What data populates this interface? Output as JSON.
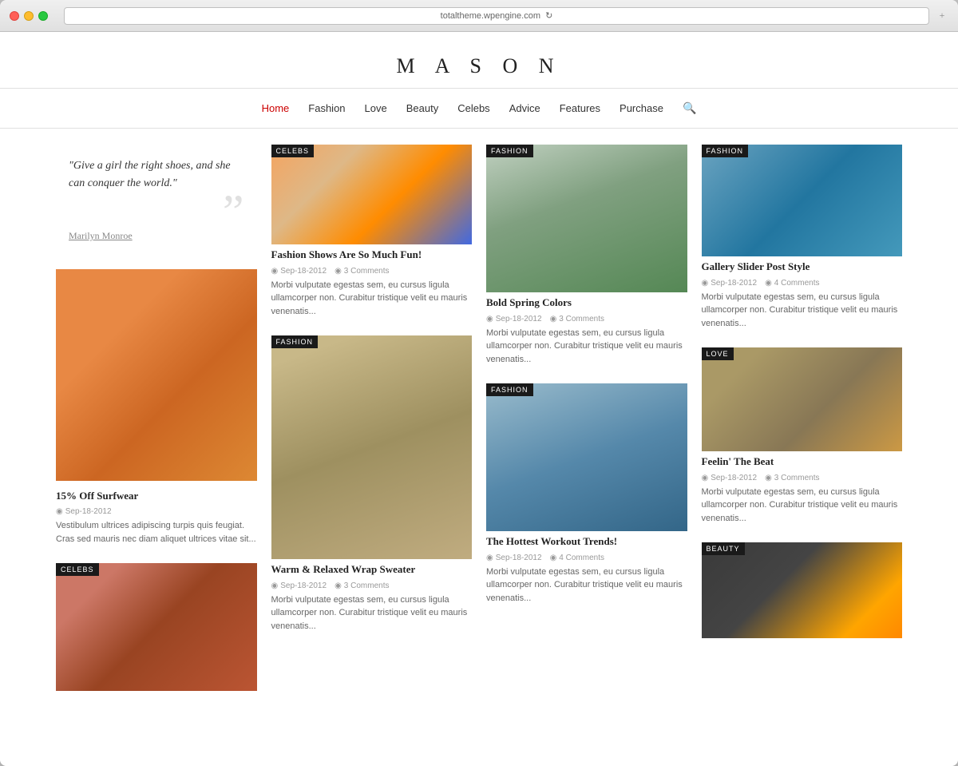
{
  "browser": {
    "url": "totaltheme.wpengine.com",
    "refresh_icon": "↻"
  },
  "site": {
    "title": "M A S O N"
  },
  "nav": {
    "items": [
      {
        "label": "Home",
        "active": true
      },
      {
        "label": "Fashion",
        "active": false
      },
      {
        "label": "Love",
        "active": false
      },
      {
        "label": "Beauty",
        "active": false
      },
      {
        "label": "Celebs",
        "active": false
      },
      {
        "label": "Advice",
        "active": false
      },
      {
        "label": "Features",
        "active": false
      },
      {
        "label": "Purchase",
        "active": false
      }
    ]
  },
  "quote": {
    "text": "\"Give a girl the right shoes, and she can conquer the world.\"",
    "author": "Marilyn Monroe",
    "mark": "”"
  },
  "articles": [
    {
      "id": "article-celebs-1",
      "category": "CELEBS",
      "title": "Fashion Shows Are So Much Fun!",
      "date": "Sep-18-2012",
      "comments": "3 Comments",
      "excerpt": "Morbi vulputate egestas sem, eu cursus ligula ullamcorper non. Curabitur tristique velit eu mauris venenatis..."
    },
    {
      "id": "article-surfwear",
      "category": "",
      "title": "15% Off Surfwear",
      "date": "Sep-18-2012",
      "comments": "",
      "excerpt": "Vestibulum ultrices adipiscing turpis quis feugiat. Cras sed mauris nec diam aliquet ultrices vitae sit..."
    },
    {
      "id": "article-fashion-2",
      "category": "FASHION",
      "title": "Warm & Relaxed Wrap Sweater",
      "date": "Sep-18-2012",
      "comments": "3 Comments",
      "excerpt": "Morbi vulputate egestas sem, eu cursus ligula ullamcorper non. Curabitur tristique velit eu mauris venenatis..."
    },
    {
      "id": "article-celebs-2",
      "category": "CELEBS",
      "title": "",
      "date": "",
      "comments": "",
      "excerpt": ""
    },
    {
      "id": "article-bold-spring",
      "category": "FASHION",
      "title": "Bold Spring Colors",
      "date": "Sep-18-2012",
      "comments": "3 Comments",
      "excerpt": "Morbi vulputate egestas sem, eu cursus ligula ullamcorper non. Curabitur tristique velit eu mauris venenatis..."
    },
    {
      "id": "article-workout",
      "category": "FASHION",
      "title": "The Hottest Workout Trends!",
      "date": "Sep-18-2012",
      "comments": "4 Comments",
      "excerpt": "Morbi vulputate egestas sem, eu cursus ligula ullamcorper non. Curabitur tristique velit eu mauris venenatis..."
    },
    {
      "id": "article-gallery",
      "category": "FASHION",
      "title": "Gallery Slider Post Style",
      "date": "Sep-18-2012",
      "comments": "4 Comments",
      "excerpt": "Morbi vulputate egestas sem, eu cursus ligula ullamcorper non. Curabitur tristique velit eu mauris venenatis..."
    },
    {
      "id": "article-feelin",
      "category": "LOVE",
      "title": "Feelin' The Beat",
      "date": "Sep-18-2012",
      "comments": "3 Comments",
      "excerpt": "Morbi vulputate egestas sem, eu cursus ligula ullamcorper non. Curabitur tristique velit eu mauris venenatis..."
    },
    {
      "id": "article-beauty",
      "category": "BEAUTY",
      "title": "",
      "date": "",
      "comments": "",
      "excerpt": ""
    }
  ],
  "meta_icons": {
    "clock": "○",
    "comment": "○"
  }
}
